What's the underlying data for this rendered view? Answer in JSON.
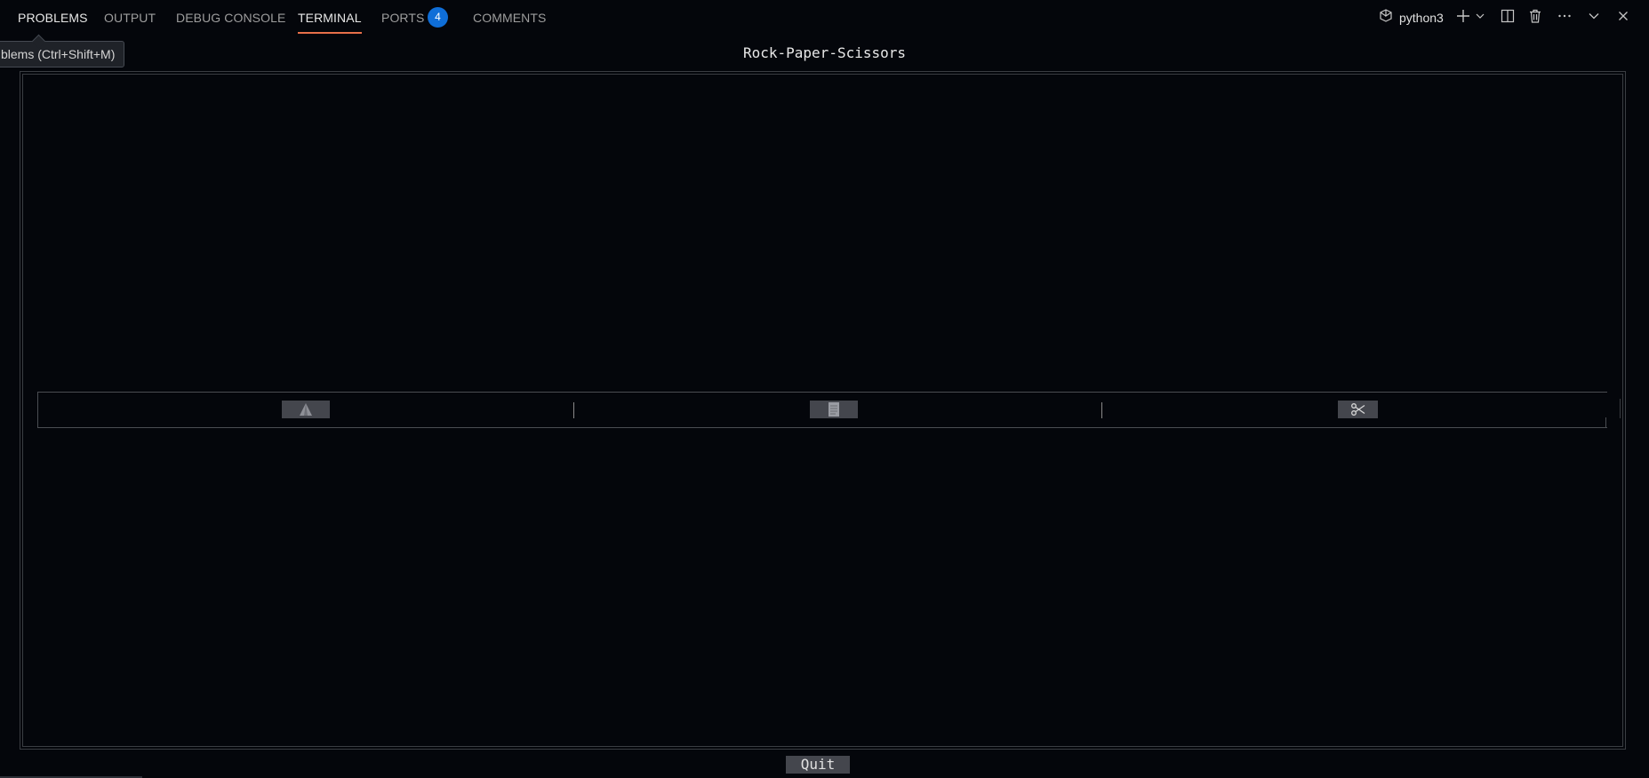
{
  "panel_tabs": [
    {
      "label": "PROBLEMS"
    },
    {
      "label": "OUTPUT"
    },
    {
      "label": "DEBUG CONSOLE"
    },
    {
      "label": "TERMINAL"
    },
    {
      "label": "PORTS",
      "badge": "4"
    },
    {
      "label": "COMMENTS"
    }
  ],
  "tooltip": {
    "text": "blems (Ctrl+Shift+M)"
  },
  "toolbar": {
    "terminal_name": "python3",
    "icons": [
      "terminal-profile-icon",
      "plus-icon",
      "chevron-down-icon",
      "split-icon",
      "trash-icon",
      "ellipsis-icon",
      "chevron-down-icon",
      "close-icon"
    ]
  },
  "app": {
    "title": "Rock-Paper-Scissors",
    "choices": [
      {
        "name": "rock",
        "icon": "rock-icon"
      },
      {
        "name": "paper",
        "icon": "paper-icon"
      },
      {
        "name": "scissors",
        "icon": "scissors-icon"
      }
    ],
    "quit_label": "Quit"
  },
  "colors": {
    "background": "#04060b",
    "active_tab_underline": "#e8704a",
    "badge": "#0f6ed8",
    "button_bg": "#44464d",
    "frame": "#3a3d42"
  }
}
